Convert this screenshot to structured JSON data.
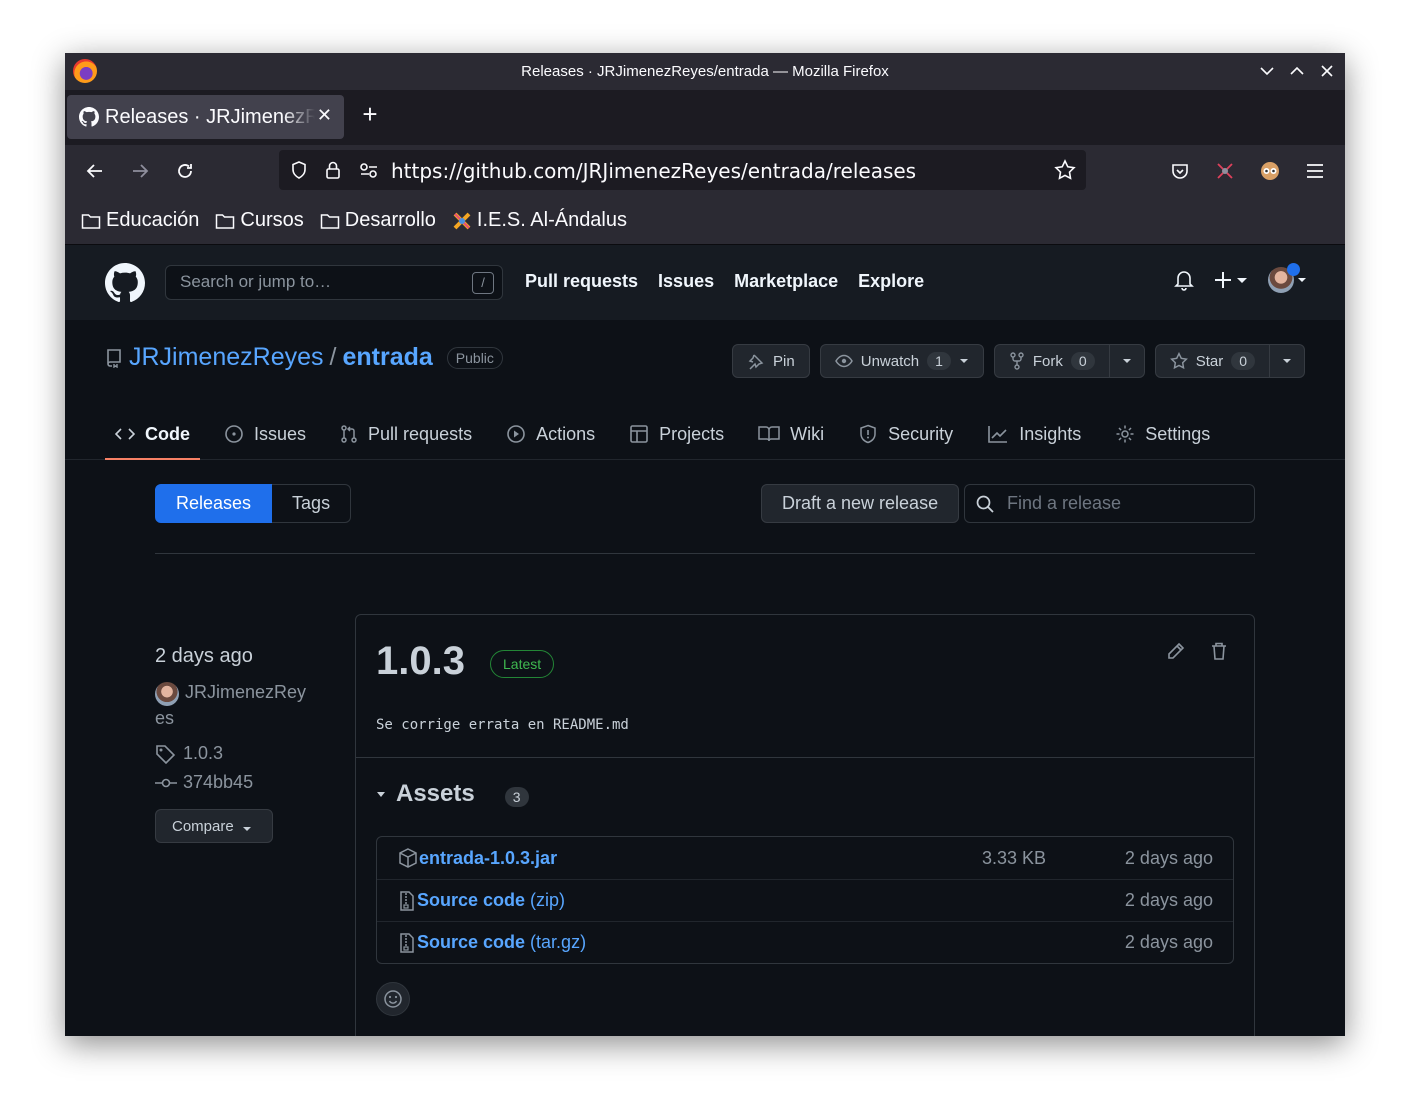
{
  "window": {
    "title": "Releases · JRJimenezReyes/entrada — Mozilla Firefox",
    "tab_title": "Releases · JRJimenezReyes/entrada",
    "url": "https://github.com/JRJimenezReyes/entrada/releases"
  },
  "bookmarks": [
    {
      "label": "Educación",
      "icon": "folder-icon"
    },
    {
      "label": "Cursos",
      "icon": "folder-icon"
    },
    {
      "label": "Desarrollo",
      "icon": "folder-icon"
    },
    {
      "label": "I.E.S. Al-Ándalus",
      "icon": "site-favicon"
    }
  ],
  "gh_header": {
    "search_placeholder": "Search or jump to…",
    "search_shortcut": "/",
    "nav": [
      "Pull requests",
      "Issues",
      "Marketplace",
      "Explore"
    ]
  },
  "repo": {
    "owner": "JRJimenezReyes",
    "separator": "/",
    "name": "entrada",
    "visibility": "Public",
    "pin_label": "Pin",
    "watch_label": "Unwatch",
    "watch_count": "1",
    "fork_label": "Fork",
    "fork_count": "0",
    "star_label": "Star",
    "star_count": "0",
    "tabs": [
      "Code",
      "Issues",
      "Pull requests",
      "Actions",
      "Projects",
      "Wiki",
      "Security",
      "Insights",
      "Settings"
    ]
  },
  "releases_page": {
    "subnav_releases": "Releases",
    "subnav_tags": "Tags",
    "draft_label": "Draft a new release",
    "find_placeholder": "Find a release"
  },
  "release": {
    "date": "2 days ago",
    "author": "JRJimenezRey",
    "author_wrap": "es",
    "tag": "1.0.3",
    "commit": "374bb45",
    "compare_label": "Compare",
    "version": "1.0.3",
    "latest_label": "Latest",
    "notes": "Se corrige errata en README.md",
    "assets_title": "Assets",
    "assets_count": "3",
    "assets": [
      {
        "name": "entrada-1.0.3.jar",
        "ext": "",
        "size": "3.33 KB",
        "date": "2 days ago",
        "icon": "package-icon"
      },
      {
        "name": "Source code",
        "ext": "(zip)",
        "size": "",
        "date": "2 days ago",
        "icon": "file-zip-icon"
      },
      {
        "name": "Source code",
        "ext": "(tar.gz)",
        "size": "",
        "date": "2 days ago",
        "icon": "file-zip-icon"
      }
    ]
  },
  "colors": {
    "accent": "#58a6ff",
    "primary_button": "#1f6feb",
    "latest_green": "#3fb950",
    "tab_underline": "#f78166"
  }
}
